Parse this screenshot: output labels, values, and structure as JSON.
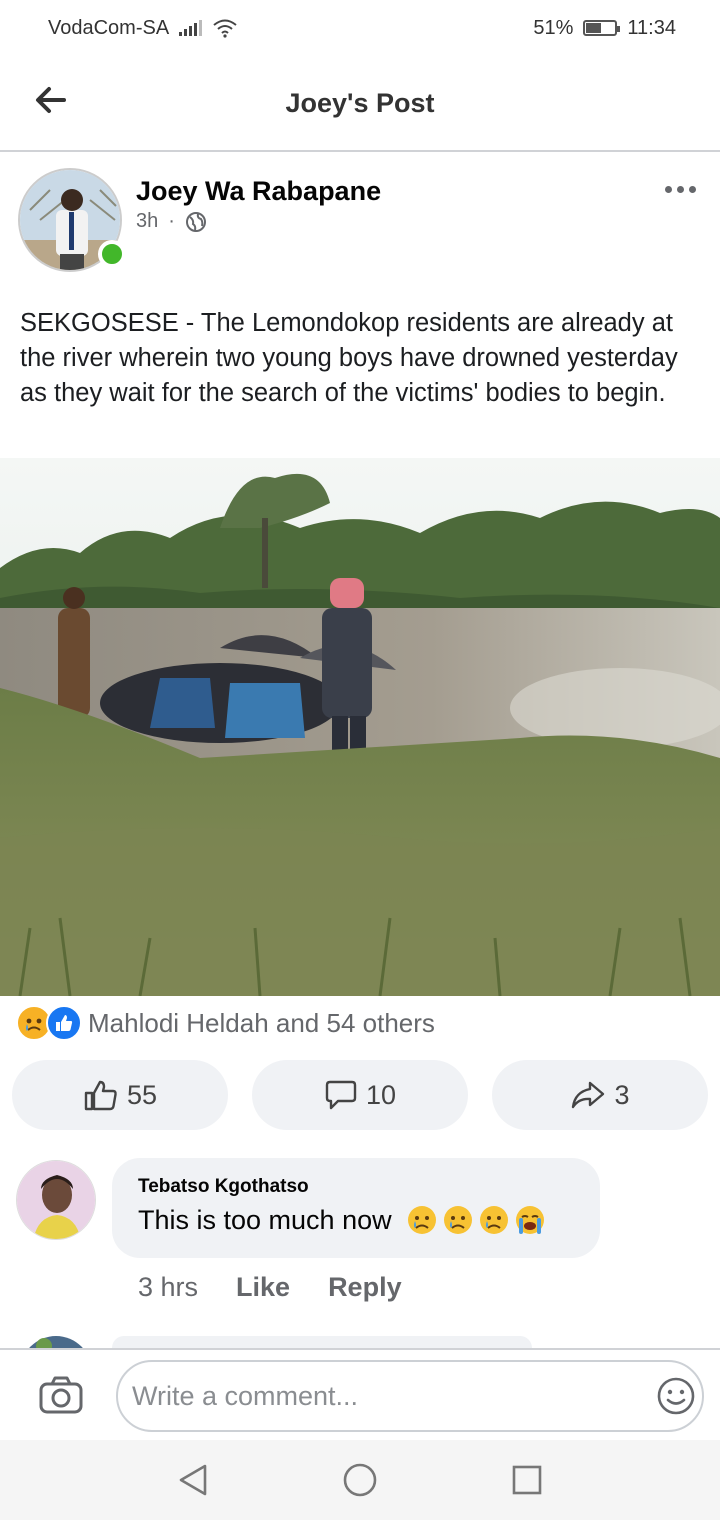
{
  "status_bar": {
    "carrier": "VodaCom-SA",
    "battery_percent": "51%",
    "battery_level": 0.51,
    "time": "11:34"
  },
  "header": {
    "title": "Joey's Post"
  },
  "post": {
    "author": "Joey Wa Rabapane",
    "time_ago": "3h",
    "separator": "·",
    "privacy_icon": "globe-icon",
    "text": "SEKGOSESE - The Lemondokop residents are already at the river wherein two young boys have drowned yesterday as they wait for the search of the victims' bodies to begin.",
    "reactions_summary": "Mahlodi Heldah and 54 others",
    "like_count": "55",
    "comment_count": "10",
    "share_count": "3"
  },
  "comments": [
    {
      "author": "Tebatso Kgothatso",
      "text": "This is too much now",
      "emojis": [
        "sad-emoji",
        "sad-emoji",
        "sad-emoji",
        "crying-emoji"
      ],
      "time": "3 hrs",
      "like_label": "Like",
      "reply_label": "Reply"
    }
  ],
  "composer": {
    "placeholder": "Write a comment..."
  },
  "colors": {
    "online": "#42b72a",
    "like_blue": "#1877f2",
    "reaction_yellow": "#f7b125",
    "secondary_text": "#65676b",
    "bubble_bg": "#f0f2f5"
  }
}
